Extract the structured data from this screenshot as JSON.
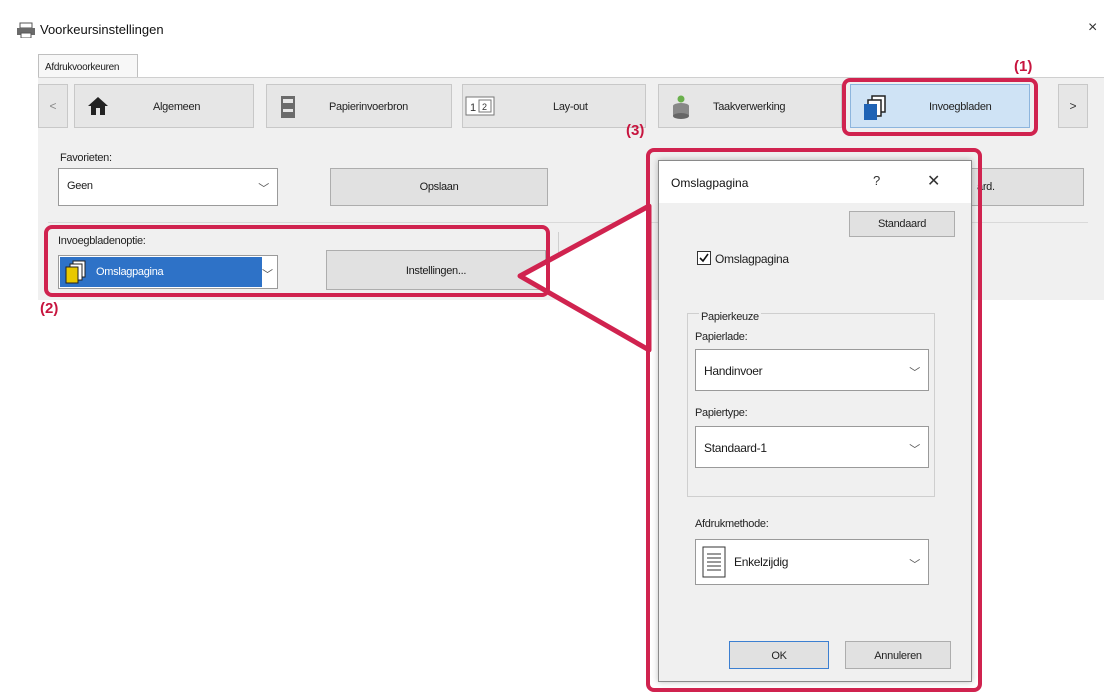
{
  "window": {
    "title": "Voorkeursinstellingen",
    "close_glyph": "×"
  },
  "tabs": {
    "active": "Afdrukvoorkeuren"
  },
  "nav": {
    "prev": "<",
    "next": ">",
    "buttons": [
      {
        "label": "Algemeen",
        "icon": "home-icon"
      },
      {
        "label": "Papierinvoerbron",
        "icon": "paper-source-icon"
      },
      {
        "label": "Lay-out",
        "icon": "layout-icon"
      },
      {
        "label": "Taakverwerking",
        "icon": "job-handling-icon"
      },
      {
        "label": "Invoegbladen",
        "icon": "inserts-icon"
      }
    ]
  },
  "favorites": {
    "label": "Favorieten:",
    "value": "Geen",
    "save_button": "Opslaan",
    "standard_button_partial": "ard."
  },
  "inserts": {
    "label": "Invoegbladenoptie:",
    "value": "Omslagpagina",
    "settings_button": "Instellingen..."
  },
  "annotations": {
    "a1": "(1)",
    "a2": "(2)",
    "a3": "(3)"
  },
  "dialog": {
    "title": "Omslagpagina",
    "help": "?",
    "close": "✕",
    "standard_button": "Standaard",
    "checkbox_label": "Omslagpagina",
    "checkbox_checked": true,
    "group_label": "Papierkeuze",
    "tray_label": "Papierlade:",
    "tray_value": "Handinvoer",
    "type_label": "Papiertype:",
    "type_value": "Standaard-1",
    "method_label": "Afdrukmethode:",
    "method_value": "Enkelzijdig",
    "ok": "OK",
    "cancel": "Annuleren"
  },
  "colors": {
    "highlight": "#d0234f",
    "selection": "#2e72c7",
    "active_tab": "#cfe3f5"
  }
}
